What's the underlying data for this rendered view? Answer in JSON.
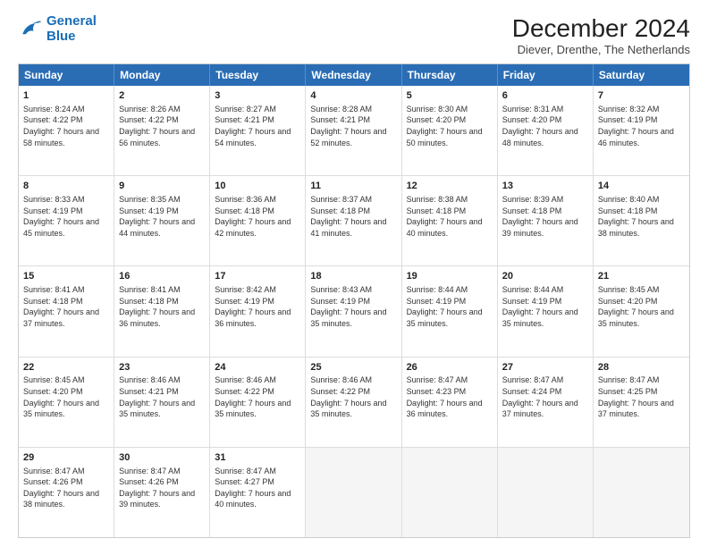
{
  "header": {
    "logo_line1": "General",
    "logo_line2": "Blue",
    "title": "December 2024",
    "subtitle": "Diever, Drenthe, The Netherlands"
  },
  "days": [
    "Sunday",
    "Monday",
    "Tuesday",
    "Wednesday",
    "Thursday",
    "Friday",
    "Saturday"
  ],
  "weeks": [
    [
      {
        "day": "1",
        "sunrise": "8:24 AM",
        "sunset": "4:22 PM",
        "daylight": "7 hours and 58 minutes."
      },
      {
        "day": "2",
        "sunrise": "8:26 AM",
        "sunset": "4:22 PM",
        "daylight": "7 hours and 56 minutes."
      },
      {
        "day": "3",
        "sunrise": "8:27 AM",
        "sunset": "4:21 PM",
        "daylight": "7 hours and 54 minutes."
      },
      {
        "day": "4",
        "sunrise": "8:28 AM",
        "sunset": "4:21 PM",
        "daylight": "7 hours and 52 minutes."
      },
      {
        "day": "5",
        "sunrise": "8:30 AM",
        "sunset": "4:20 PM",
        "daylight": "7 hours and 50 minutes."
      },
      {
        "day": "6",
        "sunrise": "8:31 AM",
        "sunset": "4:20 PM",
        "daylight": "7 hours and 48 minutes."
      },
      {
        "day": "7",
        "sunrise": "8:32 AM",
        "sunset": "4:19 PM",
        "daylight": "7 hours and 46 minutes."
      }
    ],
    [
      {
        "day": "8",
        "sunrise": "8:33 AM",
        "sunset": "4:19 PM",
        "daylight": "7 hours and 45 minutes."
      },
      {
        "day": "9",
        "sunrise": "8:35 AM",
        "sunset": "4:19 PM",
        "daylight": "7 hours and 44 minutes."
      },
      {
        "day": "10",
        "sunrise": "8:36 AM",
        "sunset": "4:18 PM",
        "daylight": "7 hours and 42 minutes."
      },
      {
        "day": "11",
        "sunrise": "8:37 AM",
        "sunset": "4:18 PM",
        "daylight": "7 hours and 41 minutes."
      },
      {
        "day": "12",
        "sunrise": "8:38 AM",
        "sunset": "4:18 PM",
        "daylight": "7 hours and 40 minutes."
      },
      {
        "day": "13",
        "sunrise": "8:39 AM",
        "sunset": "4:18 PM",
        "daylight": "7 hours and 39 minutes."
      },
      {
        "day": "14",
        "sunrise": "8:40 AM",
        "sunset": "4:18 PM",
        "daylight": "7 hours and 38 minutes."
      }
    ],
    [
      {
        "day": "15",
        "sunrise": "8:41 AM",
        "sunset": "4:18 PM",
        "daylight": "7 hours and 37 minutes."
      },
      {
        "day": "16",
        "sunrise": "8:41 AM",
        "sunset": "4:18 PM",
        "daylight": "7 hours and 36 minutes."
      },
      {
        "day": "17",
        "sunrise": "8:42 AM",
        "sunset": "4:19 PM",
        "daylight": "7 hours and 36 minutes."
      },
      {
        "day": "18",
        "sunrise": "8:43 AM",
        "sunset": "4:19 PM",
        "daylight": "7 hours and 35 minutes."
      },
      {
        "day": "19",
        "sunrise": "8:44 AM",
        "sunset": "4:19 PM",
        "daylight": "7 hours and 35 minutes."
      },
      {
        "day": "20",
        "sunrise": "8:44 AM",
        "sunset": "4:19 PM",
        "daylight": "7 hours and 35 minutes."
      },
      {
        "day": "21",
        "sunrise": "8:45 AM",
        "sunset": "4:20 PM",
        "daylight": "7 hours and 35 minutes."
      }
    ],
    [
      {
        "day": "22",
        "sunrise": "8:45 AM",
        "sunset": "4:20 PM",
        "daylight": "7 hours and 35 minutes."
      },
      {
        "day": "23",
        "sunrise": "8:46 AM",
        "sunset": "4:21 PM",
        "daylight": "7 hours and 35 minutes."
      },
      {
        "day": "24",
        "sunrise": "8:46 AM",
        "sunset": "4:22 PM",
        "daylight": "7 hours and 35 minutes."
      },
      {
        "day": "25",
        "sunrise": "8:46 AM",
        "sunset": "4:22 PM",
        "daylight": "7 hours and 35 minutes."
      },
      {
        "day": "26",
        "sunrise": "8:47 AM",
        "sunset": "4:23 PM",
        "daylight": "7 hours and 36 minutes."
      },
      {
        "day": "27",
        "sunrise": "8:47 AM",
        "sunset": "4:24 PM",
        "daylight": "7 hours and 37 minutes."
      },
      {
        "day": "28",
        "sunrise": "8:47 AM",
        "sunset": "4:25 PM",
        "daylight": "7 hours and 37 minutes."
      }
    ],
    [
      {
        "day": "29",
        "sunrise": "8:47 AM",
        "sunset": "4:26 PM",
        "daylight": "7 hours and 38 minutes."
      },
      {
        "day": "30",
        "sunrise": "8:47 AM",
        "sunset": "4:26 PM",
        "daylight": "7 hours and 39 minutes."
      },
      {
        "day": "31",
        "sunrise": "8:47 AM",
        "sunset": "4:27 PM",
        "daylight": "7 hours and 40 minutes."
      },
      null,
      null,
      null,
      null
    ]
  ]
}
